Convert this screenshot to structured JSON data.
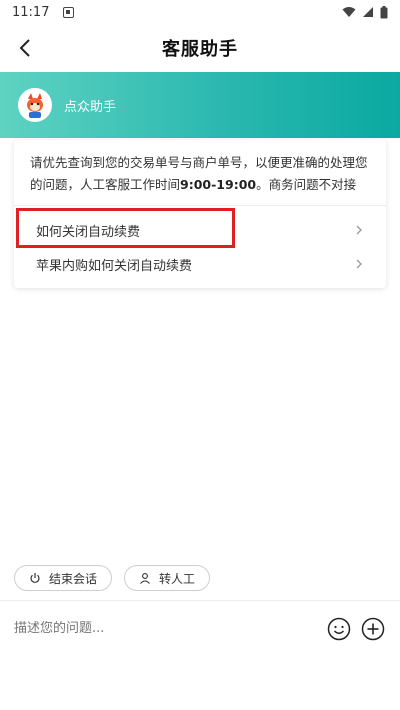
{
  "status_bar": {
    "time": "11:17"
  },
  "header": {
    "title": "客服助手"
  },
  "assistant": {
    "name": "点众助手"
  },
  "intro": {
    "text_before": "请优先查询到您的交易单号与商户单号，以便更准确的处理您的问题，人工客服工作时间",
    "hours": "9:00-19:00",
    "text_after": "。商务问题不对接"
  },
  "faq": [
    {
      "label": "如何关闭自动续费"
    },
    {
      "label": "苹果内购如何关闭自动续费"
    }
  ],
  "actions": {
    "end_session": "结束会话",
    "transfer_human": "转人工"
  },
  "input": {
    "placeholder": "描述您的问题..."
  },
  "colors": {
    "banner_start": "#5fd3c2",
    "banner_end": "#0aa9a1",
    "highlight": "#e02020"
  }
}
